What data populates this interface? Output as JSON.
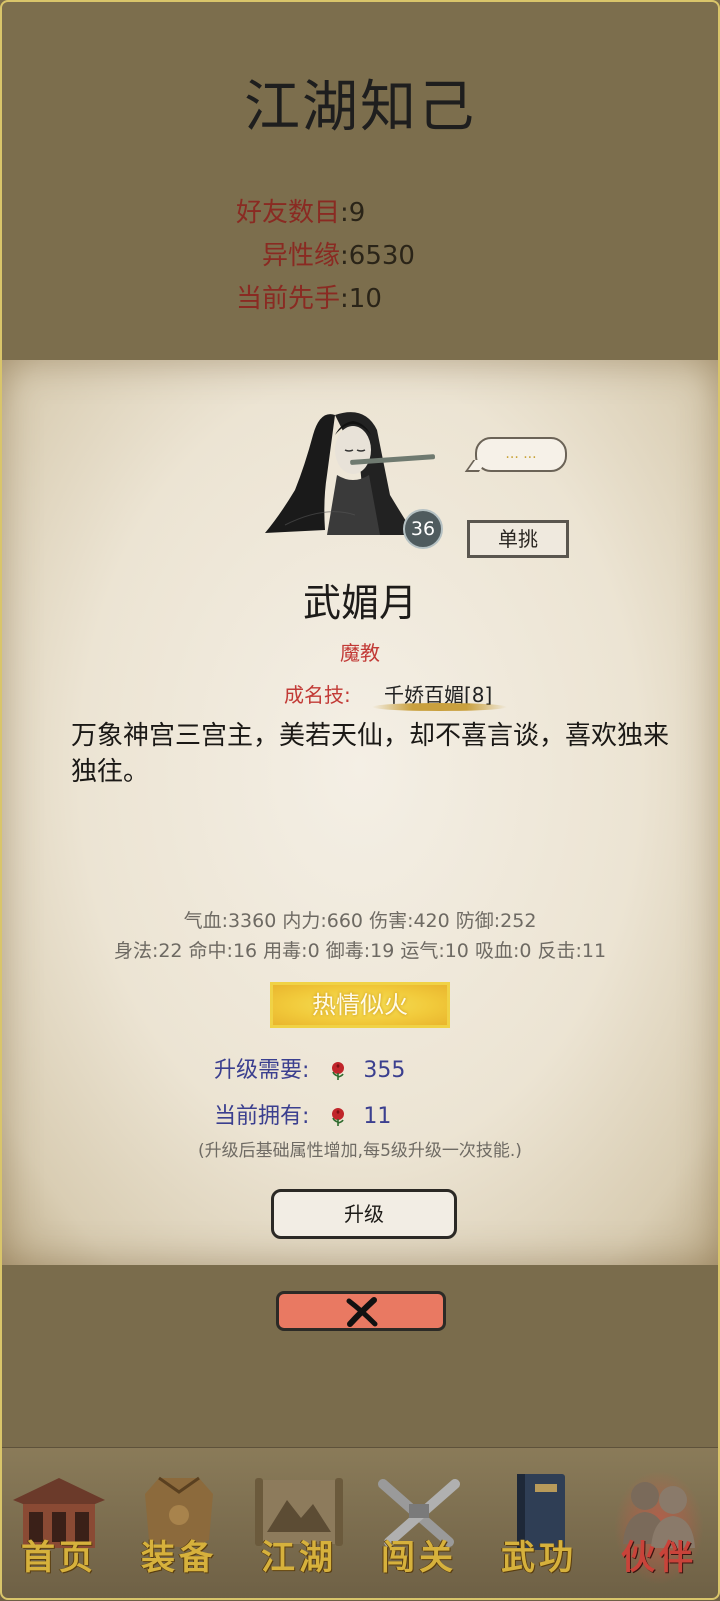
{
  "header": {
    "title": "江湖知己",
    "stats": [
      {
        "label": "好友数目",
        "value": "9"
      },
      {
        "label": "异性缘",
        "value": "6530"
      },
      {
        "label": "当前先手",
        "value": "10"
      }
    ]
  },
  "companion": {
    "level": "36",
    "speech_bubble": "... ...",
    "duel_label": "单挑",
    "name": "武媚月",
    "sect": "魔教",
    "skill_label": "成名技:",
    "skill_name": "千娇百媚[8]",
    "description": "万象神宫三宫主，美若天仙，却不喜言谈，喜欢独来独往。",
    "attributes_line1": "气血:3360  内力:660  伤害:420  防御:252",
    "attributes_line2": "身法:22  命中:16  用毒:0  御毒:19  运气:10  吸血:0  反击:11",
    "affinity_status": "热情似火",
    "upgrade_need_label": "升级需要:",
    "upgrade_need_value": "355",
    "owned_label": "当前拥有:",
    "owned_value": "11",
    "upgrade_hint": "(升级后基础属性增加,每5级升级一次技能.)",
    "upgrade_button": "升级"
  },
  "nav": {
    "items": [
      {
        "label": "首页",
        "icon": "house-icon"
      },
      {
        "label": "装备",
        "icon": "armor-icon"
      },
      {
        "label": "江湖",
        "icon": "scroll-map-icon"
      },
      {
        "label": "闯关",
        "icon": "crossed-swords-icon"
      },
      {
        "label": "武功",
        "icon": "book-icon"
      },
      {
        "label": "伙伴",
        "icon": "companions-icon"
      }
    ],
    "active": "伙伴"
  },
  "colors": {
    "accent_red": "#c23a36",
    "close_button": "#e97962",
    "affinity_gold": "#f1c93a",
    "nav_gold": "#d6b13c"
  }
}
